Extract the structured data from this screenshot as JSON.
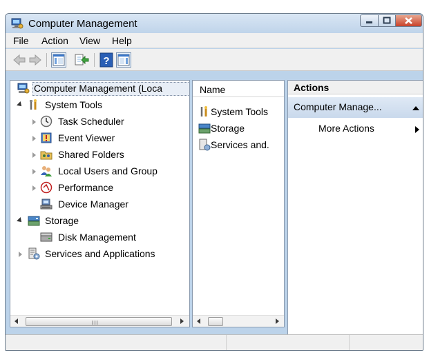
{
  "window": {
    "title": "Computer Management"
  },
  "menu": [
    "File",
    "Action",
    "View",
    "Help"
  ],
  "toolbar": {
    "buttons": [
      {
        "name": "back-button",
        "icon": "back-arrow-icon"
      },
      {
        "name": "forward-button",
        "icon": "forward-arrow-icon"
      },
      {
        "name": "show-hide-console-tree-button",
        "icon": "console-tree-icon"
      },
      {
        "name": "export-list-button",
        "icon": "export-icon"
      },
      {
        "name": "help-button",
        "icon": "help-icon"
      },
      {
        "name": "show-hide-action-pane-button",
        "icon": "action-pane-icon"
      }
    ]
  },
  "tree": {
    "root": {
      "label": "Computer Management (Loca",
      "icon": "computer-management-icon"
    },
    "items": [
      {
        "label": "System Tools",
        "icon": "tools-icon",
        "expander": "open"
      },
      {
        "label": "Task Scheduler",
        "icon": "clock-icon",
        "expander": "closed"
      },
      {
        "label": "Event Viewer",
        "icon": "event-viewer-icon",
        "expander": "closed"
      },
      {
        "label": "Shared Folders",
        "icon": "shared-folder-icon",
        "expander": "closed"
      },
      {
        "label": "Local Users and Group",
        "icon": "users-icon",
        "expander": "closed"
      },
      {
        "label": "Performance",
        "icon": "performance-icon",
        "expander": "closed"
      },
      {
        "label": "Device Manager",
        "icon": "device-manager-icon",
        "expander": "none"
      },
      {
        "label": "Storage",
        "icon": "storage-icon",
        "expander": "open"
      },
      {
        "label": "Disk Management",
        "icon": "disk-icon",
        "expander": "none"
      },
      {
        "label": "Services and Applications",
        "icon": "services-icon",
        "expander": "closed"
      }
    ],
    "scroll_grip": "III"
  },
  "list": {
    "column_header": "Name",
    "items": [
      {
        "label": "System Tools",
        "icon": "tools-icon"
      },
      {
        "label": "Storage",
        "icon": "storage-icon"
      },
      {
        "label": "Services and.",
        "icon": "services-icon"
      }
    ]
  },
  "actions": {
    "header": "Actions",
    "group_title": "Computer Manage...",
    "more_actions": "More Actions"
  },
  "colors": {
    "title_bar": "#c8dbef",
    "close_button": "#d2553a",
    "actions_group": "#d3e1f1"
  }
}
